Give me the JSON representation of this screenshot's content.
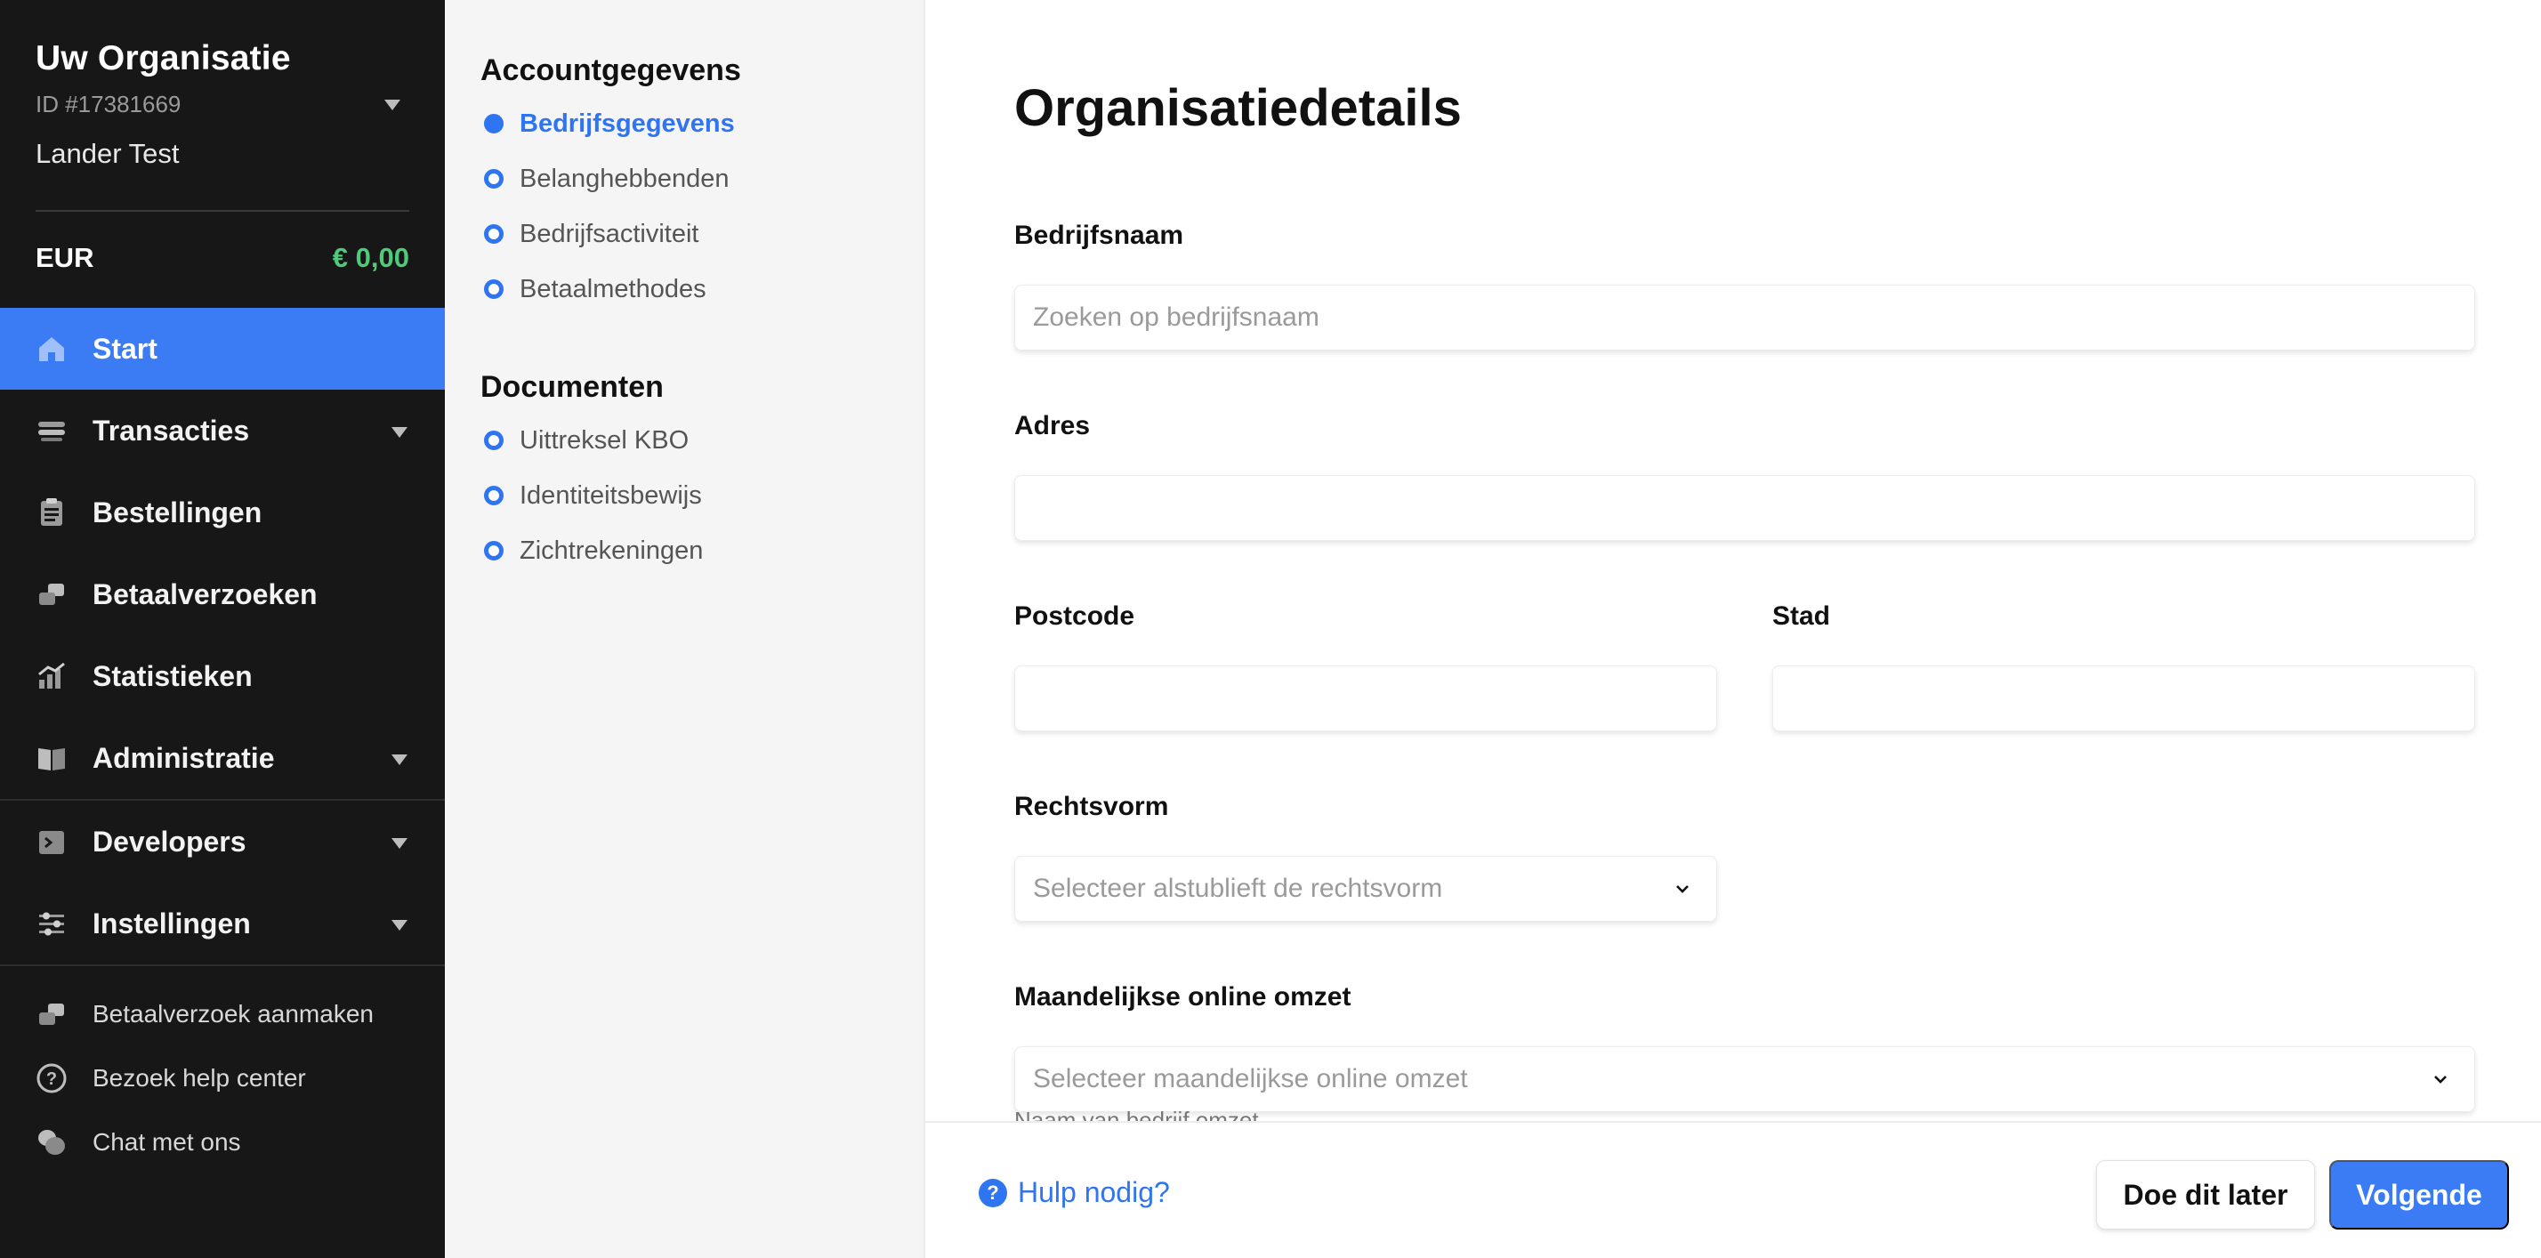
{
  "org": {
    "name": "Uw Organisatie",
    "id": "ID #17381669",
    "user": "Lander Test"
  },
  "balance": {
    "currency": "EUR",
    "amount": "€ 0,00"
  },
  "nav": {
    "start": "Start",
    "transacties": "Transacties",
    "bestellingen": "Bestellingen",
    "betaalverzoeken": "Betaalverzoeken",
    "statistieken": "Statistieken",
    "administratie": "Administratie",
    "developers": "Developers",
    "instellingen": "Instellingen"
  },
  "bottom_links": {
    "create_request": "Betaalverzoek aanmaken",
    "help_center": "Bezoek help center",
    "chat": "Chat met ons"
  },
  "steps": {
    "account_title": "Accountgegevens",
    "account_items": [
      "Bedrijfsgegevens",
      "Belanghebbenden",
      "Bedrijfsactiviteit",
      "Betaalmethodes"
    ],
    "documents_title": "Documenten",
    "document_items": [
      "Uittreksel KBO",
      "Identiteitsbewijs",
      "Zichtrekeningen"
    ]
  },
  "form": {
    "title": "Organisatiedetails",
    "company_label": "Bedrijfsnaam",
    "company_placeholder": "Zoeken op bedrijfsnaam",
    "address_label": "Adres",
    "postcode_label": "Postcode",
    "city_label": "Stad",
    "legal_form_label": "Rechtsvorm",
    "legal_form_placeholder": "Selecteer alstublieft de rechtsvorm",
    "revenue_label": "Maandelijkse online omzet",
    "revenue_placeholder": "Selecteer maandelijkse online omzet",
    "revenue_helper": "Naam van bedrijf omzet"
  },
  "footer": {
    "help": "Hulp nodig?",
    "later": "Doe dit later",
    "next": "Volgende"
  },
  "colors": {
    "accent": "#3b7cf5",
    "sidebar_bg": "#171717",
    "balance_green": "#4fc97a"
  }
}
